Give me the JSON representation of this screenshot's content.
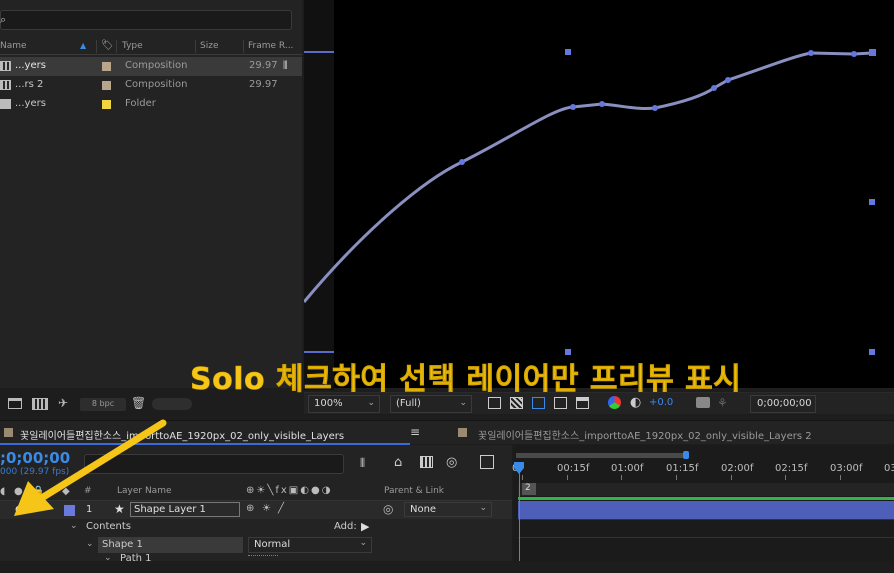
{
  "project_panel": {
    "search_icon": "search-icon",
    "columns": {
      "name": "Name",
      "type": "Type",
      "size": "Size",
      "frame_rate": "Frame R..."
    },
    "items": [
      {
        "name": "...yers",
        "type": "Composition",
        "frame_rate": "29.97",
        "label_color": "#b9a58a",
        "icon": "composition-icon",
        "selected": true
      },
      {
        "name": "...rs 2",
        "type": "Composition",
        "frame_rate": "29.97",
        "label_color": "#b9a58a",
        "icon": "composition-icon",
        "selected": false
      },
      {
        "name": "...yers",
        "type": "Folder",
        "frame_rate": "",
        "label_color": "#f1d540",
        "icon": "folder-icon",
        "selected": false
      }
    ],
    "bpc": "8 bpc"
  },
  "viewer": {
    "caption": "Solo 체크하여 선택 레이어만 프리뷰 표시",
    "zoom": "100%",
    "resolution": "(Full)",
    "exposure": "+0.0",
    "timecode": "0;00;00;00",
    "path_color": "#7b8cde"
  },
  "tabs": [
    {
      "label": "꽃일레이어들편집한소스_importtoAE_1920px_02_only_visible_Layers",
      "active": true
    },
    {
      "label": "꽃일레이어들편집한소스_importtoAE_1920px_02_only_visible_Layers 2",
      "active": false
    }
  ],
  "timeline": {
    "current_time": ";0;00;00",
    "fps": "000 (29.97 fps)",
    "columns": {
      "num": "#",
      "layer_name": "Layer Name",
      "parent": "Parent & Link"
    },
    "layer": {
      "index": "1",
      "name": "Shape Layer 1",
      "parent": "None"
    },
    "contents_label": "Contents",
    "add_label": "Add:",
    "shape_label": "Shape 1",
    "blend_mode": "Normal",
    "path_label": "Path 1",
    "ruler_ticks": [
      "0f",
      "00:15f",
      "01:00f",
      "01:15f",
      "02:00f",
      "02:15f",
      "03:00f",
      "03"
    ],
    "layer_bar_color": "#4e5fba",
    "accent": "#3a8ae8",
    "annotation_arrow_color": "#f5c518"
  }
}
